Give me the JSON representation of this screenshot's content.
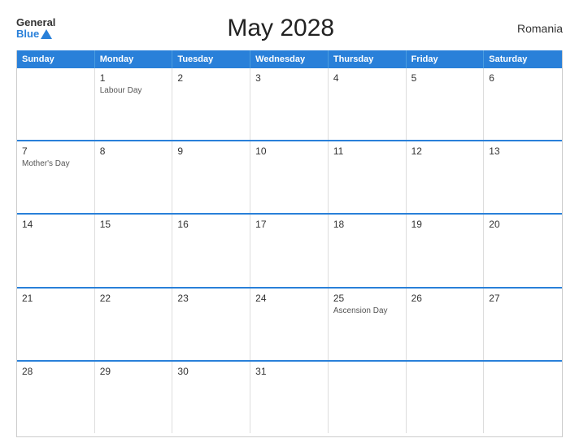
{
  "header": {
    "logo_general": "General",
    "logo_blue": "Blue",
    "title": "May 2028",
    "country": "Romania"
  },
  "calendar": {
    "days_of_week": [
      "Sunday",
      "Monday",
      "Tuesday",
      "Wednesday",
      "Thursday",
      "Friday",
      "Saturday"
    ],
    "weeks": [
      [
        {
          "day": "",
          "holiday": ""
        },
        {
          "day": "1",
          "holiday": "Labour Day"
        },
        {
          "day": "2",
          "holiday": ""
        },
        {
          "day": "3",
          "holiday": ""
        },
        {
          "day": "4",
          "holiday": ""
        },
        {
          "day": "5",
          "holiday": ""
        },
        {
          "day": "6",
          "holiday": ""
        }
      ],
      [
        {
          "day": "7",
          "holiday": "Mother's Day"
        },
        {
          "day": "8",
          "holiday": ""
        },
        {
          "day": "9",
          "holiday": ""
        },
        {
          "day": "10",
          "holiday": ""
        },
        {
          "day": "11",
          "holiday": ""
        },
        {
          "day": "12",
          "holiday": ""
        },
        {
          "day": "13",
          "holiday": ""
        }
      ],
      [
        {
          "day": "14",
          "holiday": ""
        },
        {
          "day": "15",
          "holiday": ""
        },
        {
          "day": "16",
          "holiday": ""
        },
        {
          "day": "17",
          "holiday": ""
        },
        {
          "day": "18",
          "holiday": ""
        },
        {
          "day": "19",
          "holiday": ""
        },
        {
          "day": "20",
          "holiday": ""
        }
      ],
      [
        {
          "day": "21",
          "holiday": ""
        },
        {
          "day": "22",
          "holiday": ""
        },
        {
          "day": "23",
          "holiday": ""
        },
        {
          "day": "24",
          "holiday": ""
        },
        {
          "day": "25",
          "holiday": "Ascension Day"
        },
        {
          "day": "26",
          "holiday": ""
        },
        {
          "day": "27",
          "holiday": ""
        }
      ],
      [
        {
          "day": "28",
          "holiday": ""
        },
        {
          "day": "29",
          "holiday": ""
        },
        {
          "day": "30",
          "holiday": ""
        },
        {
          "day": "31",
          "holiday": ""
        },
        {
          "day": "",
          "holiday": ""
        },
        {
          "day": "",
          "holiday": ""
        },
        {
          "day": "",
          "holiday": ""
        }
      ]
    ]
  }
}
